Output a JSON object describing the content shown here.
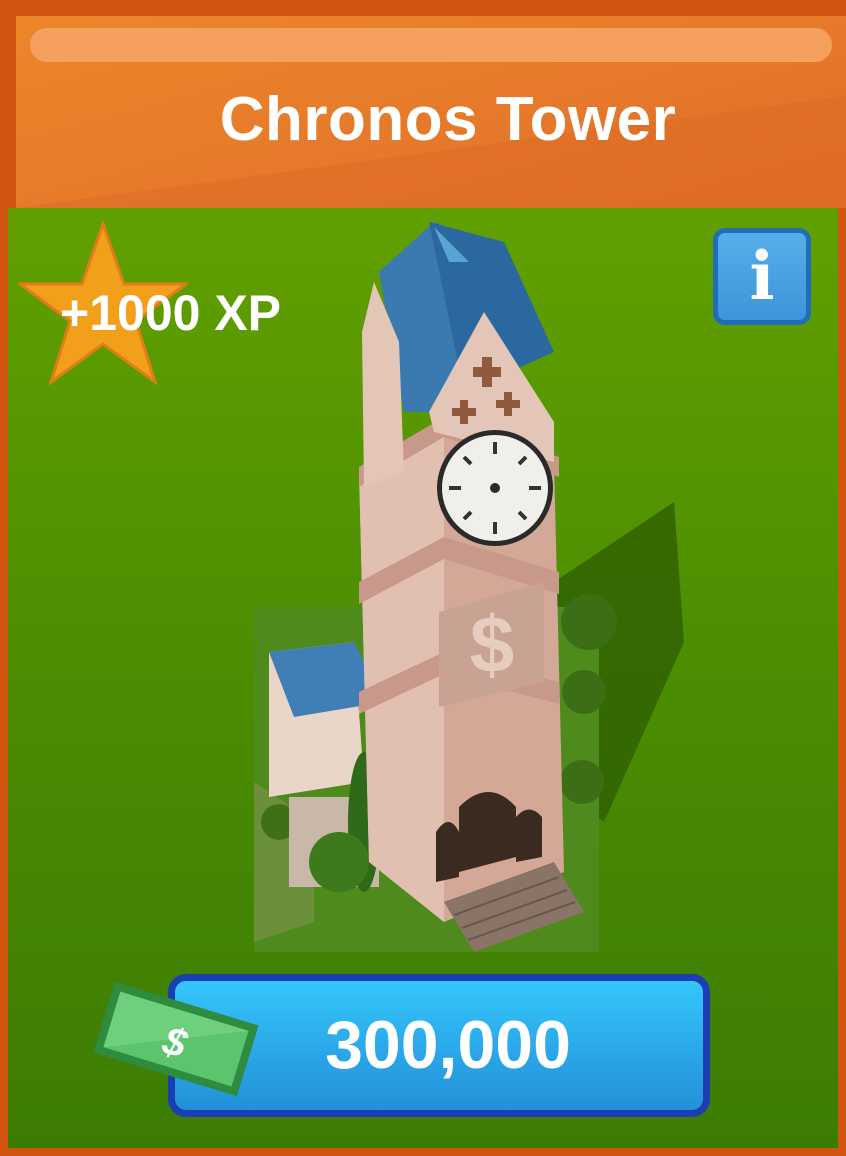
{
  "header": {
    "title": "Chronos Tower"
  },
  "reward": {
    "xp_label": "+1000 XP"
  },
  "info_button": {
    "label": "i"
  },
  "purchase": {
    "price": "300,000",
    "currency_symbol": "$"
  },
  "building": {
    "sign_symbol": "$"
  },
  "colors": {
    "header_orange": "#e5782a",
    "border_orange": "#d2560f",
    "field_green": "#4c8f02",
    "star_orange": "#f2a01c",
    "price_blue": "#2aa7e9",
    "price_border": "#1a3fb4",
    "info_blue": "#3d95d9",
    "cash_green": "#3d9a4a"
  },
  "icons": [
    "star-icon",
    "info-icon",
    "cash-bill-icon"
  ]
}
